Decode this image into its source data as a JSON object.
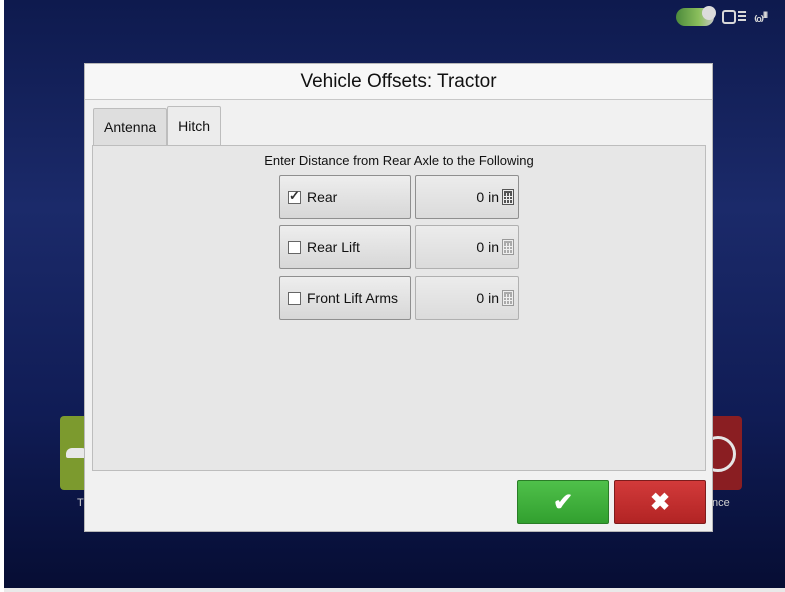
{
  "dialog": {
    "title": "Vehicle Offsets: Tractor",
    "tabs": [
      {
        "label": "Antenna",
        "active": false
      },
      {
        "label": "Hitch",
        "active": true
      }
    ],
    "heading": "Enter Distance from Rear Axle to the Following",
    "rows": [
      {
        "label": "Rear",
        "checked": true,
        "value": "0 in",
        "enabled": true
      },
      {
        "label": "Rear Lift",
        "checked": false,
        "value": "0 in",
        "enabled": false
      },
      {
        "label": "Front Lift Arms",
        "checked": false,
        "value": "0 in",
        "enabled": false
      }
    ],
    "ok_symbol": "✔",
    "cancel_symbol": "✖"
  },
  "background": {
    "left_tile_label": "Ti",
    "right_tile_label": "nce"
  },
  "status_bar": {
    "icons": [
      "gps-status-icon",
      "display-icon",
      "signal-icon"
    ],
    "signal_text": "₍ₒ₎ᴵᴵᴵ"
  },
  "colors": {
    "ok": "#3aa837",
    "cancel": "#c32e2e",
    "background": "#14236a"
  }
}
